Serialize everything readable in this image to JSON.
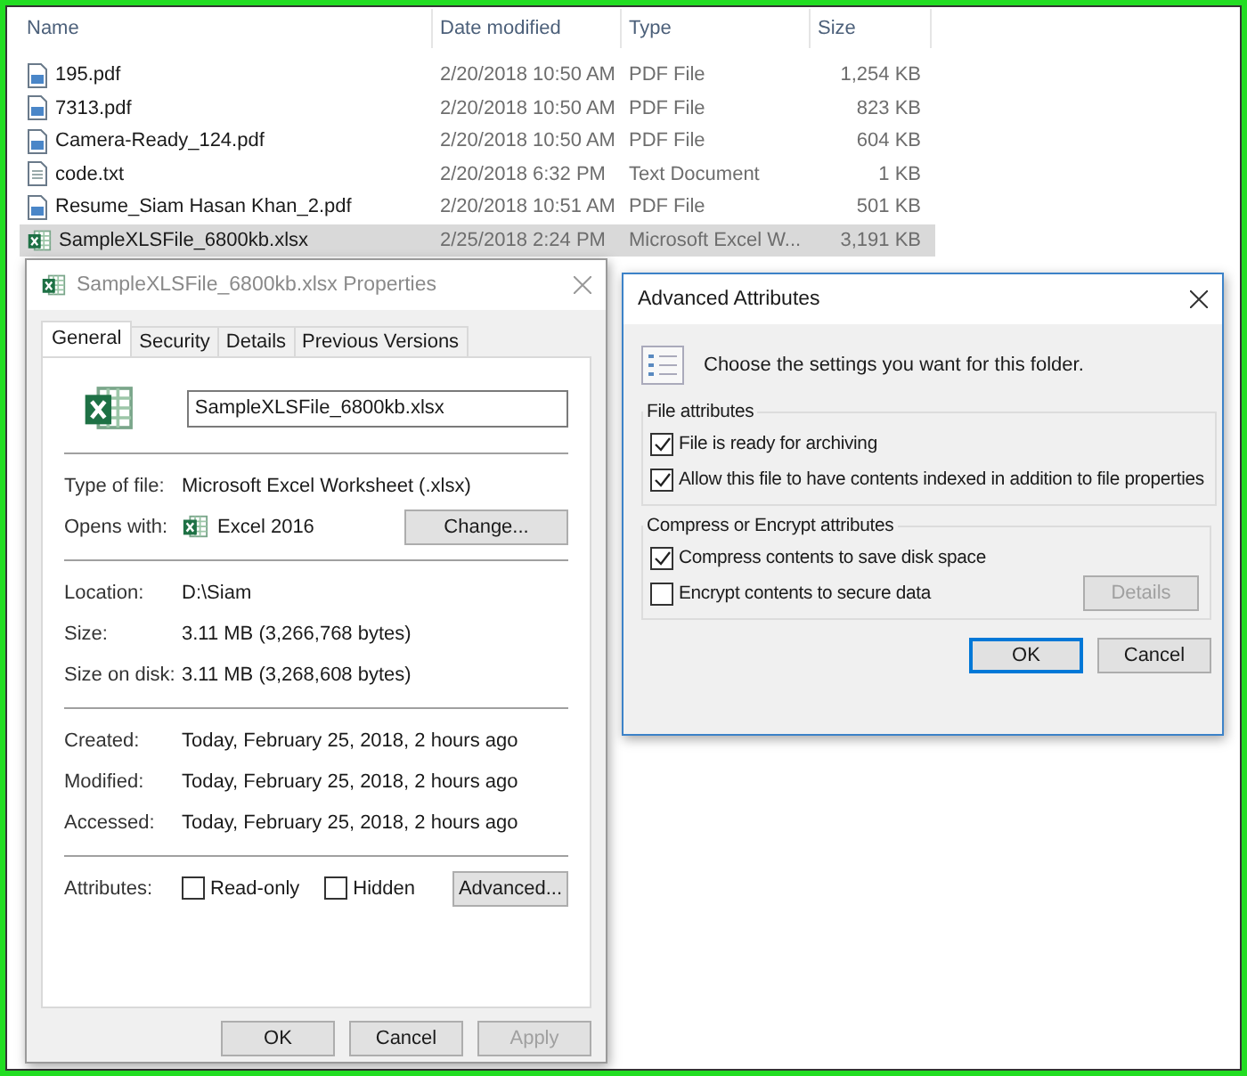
{
  "explorer": {
    "columns": [
      "Name",
      "Date modified",
      "Type",
      "Size"
    ],
    "rows": [
      {
        "kind": "pdf",
        "name": "195.pdf",
        "date": "2/20/2018 10:50 AM",
        "type": "PDF File",
        "size": "1,254 KB",
        "selected": false
      },
      {
        "kind": "pdf",
        "name": "7313.pdf",
        "date": "2/20/2018 10:50 AM",
        "type": "PDF File",
        "size": "823 KB",
        "selected": false
      },
      {
        "kind": "pdf",
        "name": "Camera-Ready_124.pdf",
        "date": "2/20/2018 10:50 AM",
        "type": "PDF File",
        "size": "604 KB",
        "selected": false
      },
      {
        "kind": "txt",
        "name": "code.txt",
        "date": "2/20/2018 6:32 PM",
        "type": "Text Document",
        "size": "1 KB",
        "selected": false
      },
      {
        "kind": "pdf",
        "name": "Resume_Siam Hasan Khan_2.pdf",
        "date": "2/20/2018 10:51 AM",
        "type": "PDF File",
        "size": "501 KB",
        "selected": false
      },
      {
        "kind": "xlsx",
        "name": "SampleXLSFile_6800kb.xlsx",
        "date": "2/25/2018 2:24 PM",
        "type": "Microsoft Excel W...",
        "size": "3,191 KB",
        "selected": true
      }
    ]
  },
  "properties": {
    "title": "SampleXLSFile_6800kb.xlsx Properties",
    "tabs": [
      {
        "label": "General",
        "selected": true
      },
      {
        "label": "Security",
        "selected": false
      },
      {
        "label": "Details",
        "selected": false
      },
      {
        "label": "Previous Versions",
        "selected": false
      }
    ],
    "filename": "SampleXLSFile_6800kb.xlsx",
    "sections": [
      [
        {
          "label": "Type of file:",
          "value": "Microsoft Excel Worksheet (.xlsx)"
        },
        {
          "label": "Opens with:",
          "value": "Excel 2016",
          "kind": "app",
          "button": "Change..."
        }
      ],
      [
        {
          "label": "Location:",
          "value": "D:\\Siam"
        },
        {
          "label": "Size:",
          "value": "3.11 MB (3,266,768 bytes)"
        },
        {
          "label": "Size on disk:",
          "value": "3.11 MB (3,268,608 bytes)"
        }
      ],
      [
        {
          "label": "Created:",
          "value": "Today, February 25, 2018, 2 hours ago"
        },
        {
          "label": "Modified:",
          "value": "Today, February 25, 2018, 2 hours ago"
        },
        {
          "label": "Accessed:",
          "value": "Today, February 25, 2018, 2 hours ago"
        }
      ]
    ],
    "attributes": {
      "label": "Attributes:",
      "checkboxes": [
        {
          "label": "Read-only",
          "checked": false
        },
        {
          "label": "Hidden",
          "checked": false
        }
      ],
      "button": "Advanced..."
    },
    "buttons": [
      {
        "label": "OK",
        "disabled": false
      },
      {
        "label": "Cancel",
        "disabled": false
      },
      {
        "label": "Apply",
        "disabled": true
      }
    ]
  },
  "advanced": {
    "title": "Advanced Attributes",
    "intro": "Choose the settings you want for this folder.",
    "groups": [
      {
        "title": "File attributes",
        "checkboxes": [
          {
            "label": "File is ready for archiving",
            "checked": true
          },
          {
            "label": "Allow this file to have contents indexed in addition to file properties",
            "checked": true
          }
        ]
      },
      {
        "title": "Compress or Encrypt attributes",
        "checkboxes": [
          {
            "label": "Compress contents to save disk space",
            "checked": true
          },
          {
            "label": "Encrypt contents to secure data",
            "checked": false
          }
        ],
        "button": {
          "label": "Details",
          "disabled": true
        }
      }
    ],
    "buttons": [
      {
        "label": "OK",
        "default": true
      },
      {
        "label": "Cancel",
        "default": false
      }
    ]
  }
}
